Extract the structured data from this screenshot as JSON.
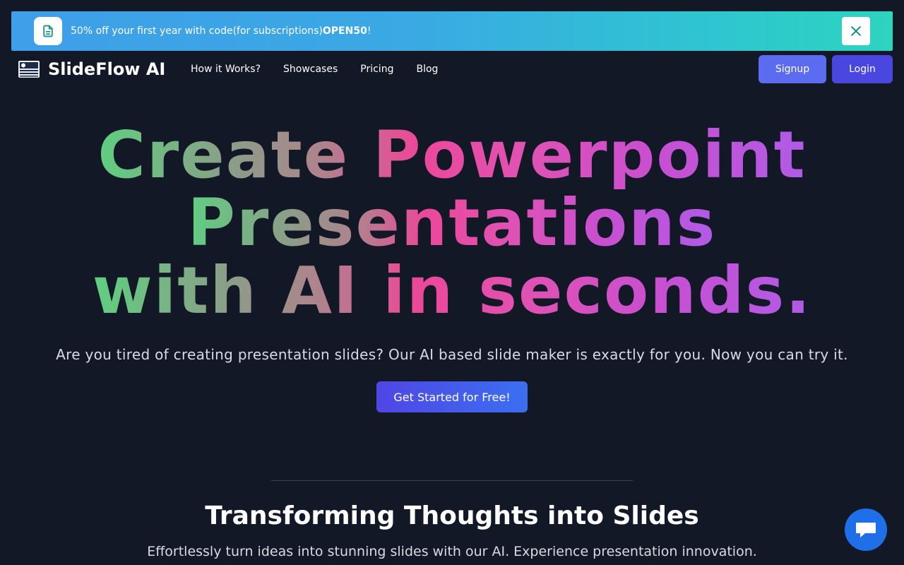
{
  "banner": {
    "text": "50% off your first year with code(for subscriptions) ",
    "code": "OPEN50",
    "suffix": "!",
    "doc_icon": "document-icon",
    "close_icon": "close-icon"
  },
  "brand": {
    "name": "SlideFlow AI",
    "logo_icon": "slides-logo-icon"
  },
  "nav": {
    "items": [
      "How it Works?",
      "Showcases",
      "Pricing",
      "Blog"
    ]
  },
  "auth": {
    "signup": "Signup",
    "login": "Login"
  },
  "hero": {
    "line1": "Create Powerpoint",
    "line2": "Presentations",
    "line3": "with AI in seconds.",
    "subtitle": "Are you tired of creating presentation slides? Our AI based slide maker is exactly for you. Now you can try it.",
    "cta": "Get Started for Free!"
  },
  "section": {
    "title": "Transforming Thoughts into Slides",
    "subtitle": "Effortlessly turn ideas into stunning slides with our AI. Experience presentation innovation."
  },
  "chat": {
    "icon": "chat-icon"
  },
  "colors": {
    "background": "#121826",
    "banner_start": "#3f9fe8",
    "banner_end": "#2dd4bf",
    "accent": "#4f46e5",
    "chat": "#1f6fe8"
  }
}
